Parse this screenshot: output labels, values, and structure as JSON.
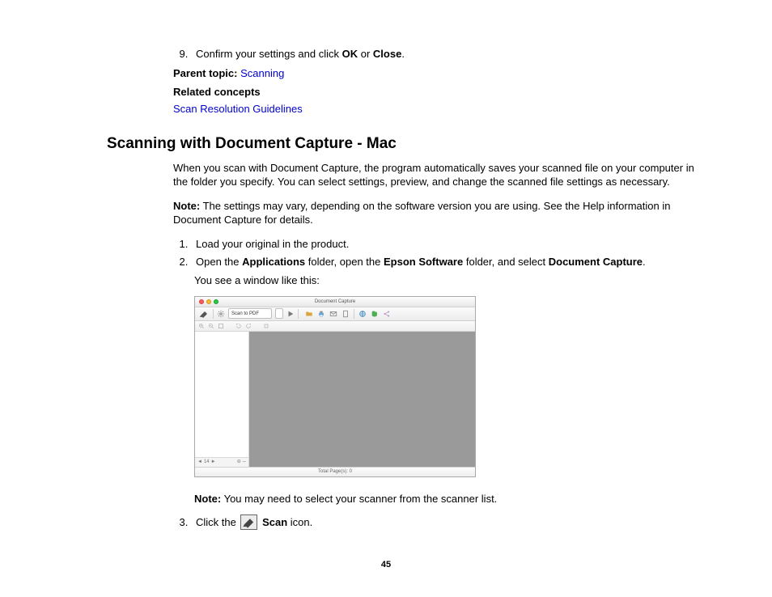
{
  "step9": {
    "num": "9.",
    "pre": "Confirm your settings and click ",
    "b1": "OK",
    "mid": " or ",
    "b2": "Close",
    "post": "."
  },
  "parentTopic": {
    "label": "Parent topic:",
    "link": "Scanning"
  },
  "relatedConcepts": {
    "label": "Related concepts",
    "link1": "Scan Resolution Guidelines"
  },
  "heading": "Scanning with Document Capture - Mac",
  "intro": "When you scan with Document Capture, the program automatically saves your scanned file on your computer in the folder you specify. You can select settings, preview, and change the scanned file settings as necessary.",
  "note1": {
    "label": "Note:",
    "text": " The settings may vary, depending on the software version you are using. See the Help information in Document Capture for details."
  },
  "steps": {
    "s1": "Load your original in the product.",
    "s2": {
      "pre": "Open the ",
      "b1": "Applications",
      "mid1": " folder, open the ",
      "b2": "Epson Software",
      "mid2": " folder, and select ",
      "b3": "Document Capture",
      "post": "."
    },
    "yousee": "You see a window like this:",
    "s3": {
      "pre": "Click the ",
      "iconword": " Scan",
      "post": " icon."
    }
  },
  "macwin": {
    "title": "Document Capture",
    "dropdown": "Scan to PDF",
    "status": "Total Page(s): 0",
    "pageVal": "14"
  },
  "note2": {
    "label": "Note:",
    "text": " You may need to select your scanner from the scanner list."
  },
  "pageNum": "45"
}
